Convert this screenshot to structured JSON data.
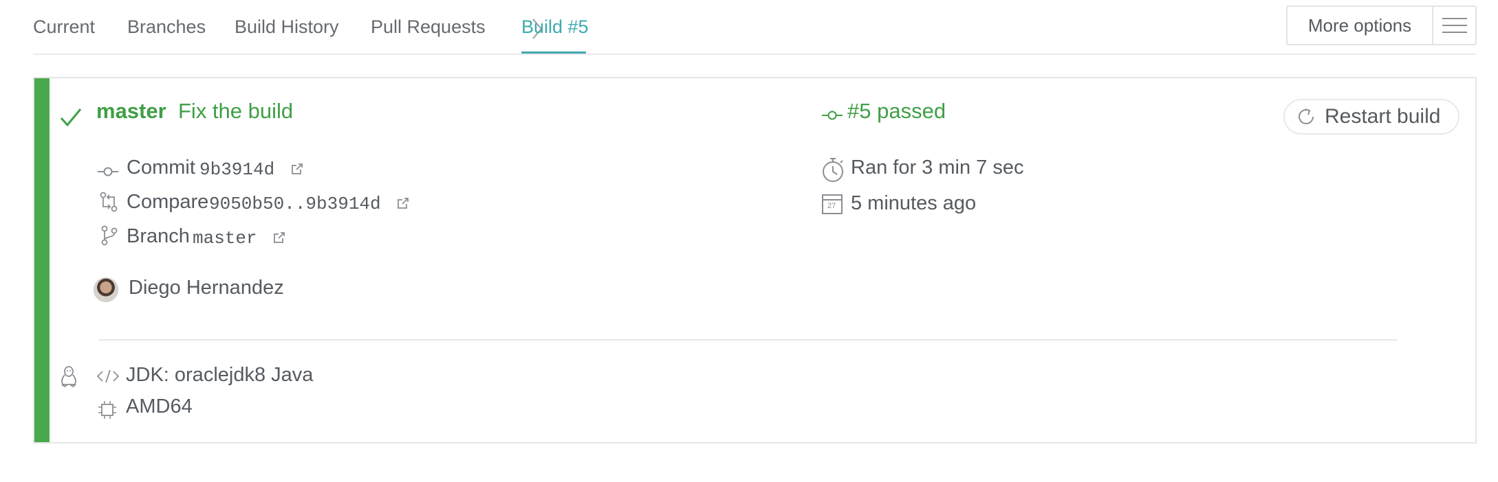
{
  "tabs": [
    {
      "label": "Current"
    },
    {
      "label": "Branches"
    },
    {
      "label": "Build History"
    },
    {
      "label": "Pull Requests"
    },
    {
      "label": "Build #5",
      "active": true
    }
  ],
  "more_options": {
    "label": "More options"
  },
  "build": {
    "status": "passed",
    "branch_name": "master",
    "commit_message": "Fix the build",
    "number_status": "#5 passed",
    "restart_label": "Restart build",
    "commit": {
      "label": "Commit",
      "value": "9b3914d"
    },
    "compare": {
      "label": "Compare",
      "value": "9050b50..9b3914d"
    },
    "branch": {
      "label": "Branch",
      "value": "master"
    },
    "author": "Diego Hernandez",
    "duration": "Ran for 3 min 7 sec",
    "finished": "5 minutes ago",
    "calendar_day": "27",
    "jdk": "JDK: oraclejdk8 Java",
    "arch": "AMD64"
  },
  "colors": {
    "accent": "#3eaaaf",
    "passed": "#3f9f45",
    "stripe": "#4aa84e"
  },
  "icons": [
    "chevron-right-icon",
    "hamburger-icon",
    "check-icon",
    "commit-icon",
    "restart-icon",
    "external-link-icon",
    "compare-icon",
    "branch-icon",
    "stopwatch-icon",
    "calendar-icon",
    "linux-icon",
    "code-icon",
    "cpu-icon"
  ]
}
